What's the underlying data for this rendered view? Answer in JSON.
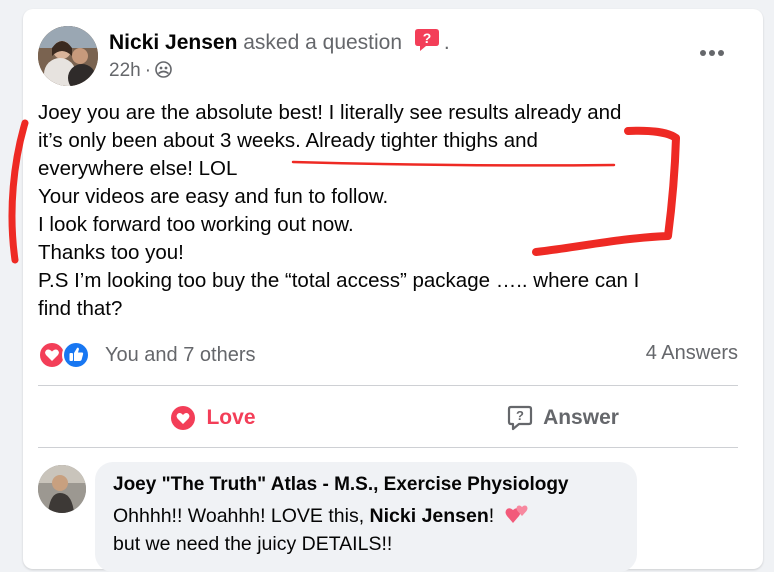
{
  "post": {
    "author_name": "Nicki Jensen",
    "action": "asked a question",
    "trailing": ".",
    "time": "22h",
    "separator": "·",
    "audience_icon": "group-icon",
    "question_icon": "question-badge-icon",
    "more_icon": "more-options-icon",
    "text_lines": [
      "Joey you are the absolute best! I literally see results already and",
      "it’s only been about 3 weeks. Already tighter thighs and",
      "everywhere else! LOL",
      "Your videos are easy and fun to follow.",
      "I look forward too working out now.",
      "Thanks too you!",
      "P.S I’m looking too buy the “total access” package ….. where can I",
      "find that?"
    ],
    "annotation_color": "#ee2a24"
  },
  "reactions": {
    "summary": "You and 7 others",
    "answers": "4 Answers",
    "icons": [
      "love-reaction-icon",
      "like-reaction-icon"
    ]
  },
  "actions": {
    "love_label": "Love",
    "answer_label": "Answer",
    "love_color": "#f33e58"
  },
  "comment": {
    "author": "Joey \"The Truth\" Atlas - M.S., Exercise Physiology",
    "line1_prefix": "Ohhhh!! Woahhh! LOVE this, ",
    "line1_mention": "Nicki Jensen",
    "line1_suffix": "!",
    "line1_emoji": "two-hearts-emoji",
    "line2": "but we need the juicy DETAILS!!"
  }
}
